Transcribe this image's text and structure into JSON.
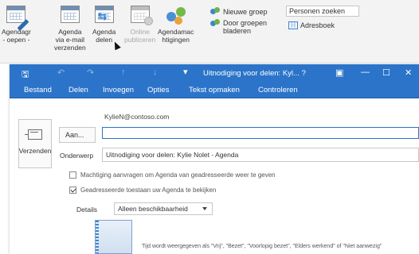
{
  "ribbon": {
    "open_calendar": "Agendagr\n- oepen -",
    "email_calendar": "Agenda\nvia e-mail\nverzenden",
    "share_calendar": "Agenda\ndelen",
    "publish_online": "Online\npubliceren",
    "calendar_permissions": "Agendamac\nhtigingen",
    "new_group": "Nieuwe groep",
    "browse_groups": "Door groepen\nbladeren",
    "search_people": "Personen zoeken",
    "address_book": "Adresboek",
    "address_book_icon": "[-]"
  },
  "window": {
    "title": "Uitnodiging voor delen: Kyl... ?",
    "menu": [
      "Bestand",
      "Delen",
      "Invoegen",
      "Opties",
      "Tekst opmaken",
      "Controleren"
    ]
  },
  "message": {
    "from": "KylieN@contoso.com",
    "send_label": "Verzenden",
    "to_label": "Aan...",
    "to_value": "",
    "subject_label": "Onderwerp",
    "subject_value": "Uitnodiging voor delen: Kylie Nolet - Agenda",
    "request_permission_label": "Machtiging aanvragen om Agenda van geadresseerde weer te geven",
    "request_permission_checked": false,
    "allow_view_label": "Geadresseerde toestaan uw Agenda te bekijken",
    "allow_view_checked": true,
    "details_label": "Details",
    "details_value": "Alleen beschikbaarheid",
    "note": "Tijd wordt weergegeven als \"Vrij\", \"Bezet\", \"Voorlopig bezet\", \"Elders werkend\" of \"Niet aanwezig\""
  },
  "icons": {
    "save": "save-icon",
    "undo": "undo-icon",
    "redo": "redo-icon",
    "minimize": "minimize-icon",
    "maximize": "maximize-icon",
    "close": "close-icon"
  },
  "colors": {
    "titlebar": "#2b74c9",
    "ribbon_bg": "#f3f3f3",
    "accent": "#2b74c9"
  }
}
